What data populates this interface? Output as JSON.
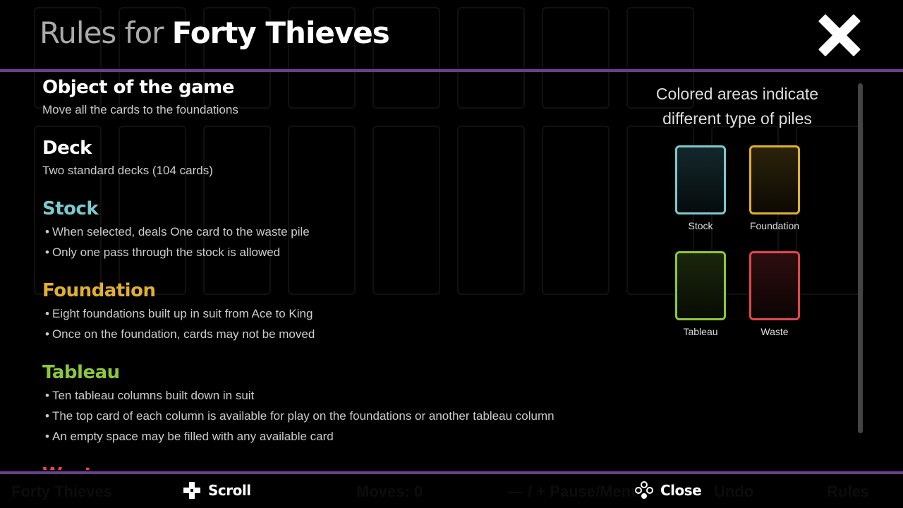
{
  "header": {
    "title_prefix": "Rules for",
    "game_name": "Forty Thieves"
  },
  "sections": [
    {
      "title": "Object of the game",
      "color": "#ffffff",
      "desc": "Move all the cards to the foundations"
    },
    {
      "title": "Deck",
      "color": "#ffffff",
      "desc": "Two standard decks (104 cards)"
    },
    {
      "title": "Stock",
      "color": "#7ec8cf",
      "bullets": [
        "When selected, deals One card to the waste pile",
        "Only one pass through the stock is allowed"
      ]
    },
    {
      "title": "Foundation",
      "color": "#e0b030",
      "bullets": [
        "Eight foundations built up in suit from Ace to King",
        "Once on the foundation, cards may not be moved"
      ]
    },
    {
      "title": "Tableau",
      "color": "#8cc63f",
      "bullets": [
        "Ten tableau columns built down in suit",
        "The top card of each column is available for play on the foundations or another tableau column",
        "An empty space may be filled with any available card"
      ]
    },
    {
      "title": "Waste",
      "color": "#e0474c"
    }
  ],
  "legend": {
    "title_line1": "Colored areas indicate",
    "title_line2": "different type of piles",
    "piles": [
      {
        "label": "Stock",
        "color": "#7ec8cf"
      },
      {
        "label": "Foundation",
        "color": "#e0b030"
      },
      {
        "label": "Tableau",
        "color": "#8cc63f"
      },
      {
        "label": "Waste",
        "color": "#e0474c"
      }
    ]
  },
  "footer": {
    "scroll_label": "Scroll",
    "close_label": "Close"
  },
  "background": {
    "game_title": "Forty Thieves",
    "moves": "Moves: 0",
    "pause": "— / + Pause/Menu",
    "undo": "Undo",
    "rules": "Rules"
  }
}
